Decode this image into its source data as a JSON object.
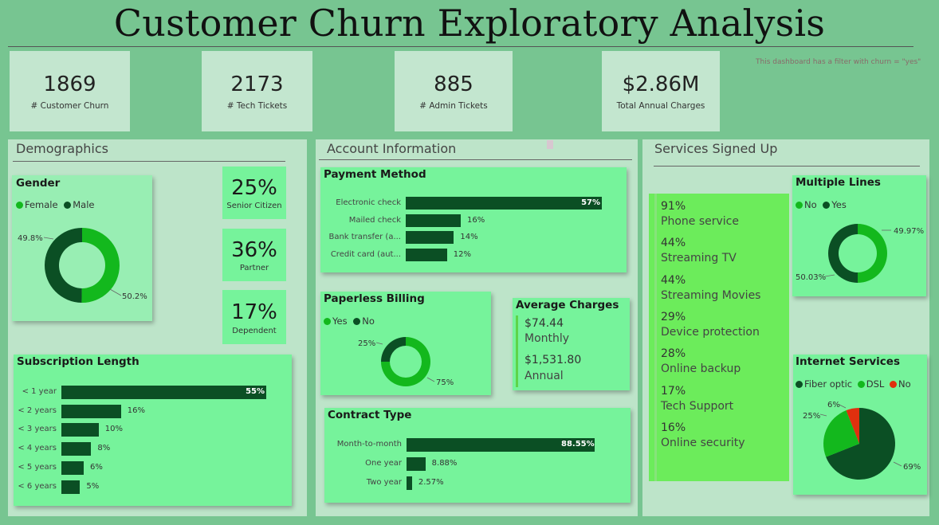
{
  "title": "Customer Churn Exploratory Analysis",
  "note": "This dashboard has a filter with churn = \"yes\"",
  "kpis": [
    {
      "value": "1869",
      "label": "# Customer Churn"
    },
    {
      "value": "2173",
      "label": "# Tech Tickets"
    },
    {
      "value": "885",
      "label": "# Admin Tickets"
    },
    {
      "value": "$2.86M",
      "label": "Total Annual Charges"
    }
  ],
  "demographics": {
    "title": "Demographics",
    "gender": {
      "title": "Gender",
      "legend": [
        "Female",
        "Male"
      ],
      "colors": {
        "female": "#13b81d",
        "male": "#0b4f24"
      },
      "female_pct": 50.2,
      "male_pct": 49.8,
      "female_label": "50.2%",
      "male_label": "49.8%"
    },
    "stats": [
      {
        "value": "25%",
        "label": "Senior Citizen"
      },
      {
        "value": "36%",
        "label": "Partner"
      },
      {
        "value": "17%",
        "label": "Dependent"
      }
    ],
    "subscription": {
      "title": "Subscription Length",
      "rows": [
        {
          "label": "< 1 year",
          "value": 55,
          "text": "55%"
        },
        {
          "label": "< 2 years",
          "value": 16,
          "text": "16%"
        },
        {
          "label": "< 3 years",
          "value": 10,
          "text": "10%"
        },
        {
          "label": "< 4 years",
          "value": 8,
          "text": "8%"
        },
        {
          "label": "< 5 years",
          "value": 6,
          "text": "6%"
        },
        {
          "label": "< 6 years",
          "value": 5,
          "text": "5%"
        }
      ]
    }
  },
  "account": {
    "title": "Account Information",
    "payment": {
      "title": "Payment Method",
      "rows": [
        {
          "label": "Electronic check",
          "value": 57,
          "text": "57%"
        },
        {
          "label": "Mailed check",
          "value": 16,
          "text": "16%"
        },
        {
          "label": "Bank transfer (a...",
          "value": 14,
          "text": "14%"
        },
        {
          "label": "Credit card (aut...",
          "value": 12,
          "text": "12%"
        }
      ]
    },
    "paperless": {
      "title": "Paperless Billing",
      "legend": [
        "Yes",
        "No"
      ],
      "yes_pct": 75,
      "no_pct": 25,
      "yes_label": "75%",
      "no_label": "25%"
    },
    "avg_charges": {
      "title": "Average Charges",
      "monthly_value": "$74.44",
      "monthly_label": "Monthly",
      "annual_value": "$1,531.80",
      "annual_label": "Annual"
    },
    "contract": {
      "title": "Contract Type",
      "rows": [
        {
          "label": "Month-to-month",
          "value": 88.55,
          "text": "88.55%"
        },
        {
          "label": "One year",
          "value": 8.88,
          "text": "8.88%"
        },
        {
          "label": "Two year",
          "value": 2.57,
          "text": "2.57%"
        }
      ]
    }
  },
  "services": {
    "title": "Services Signed Up",
    "items": [
      {
        "pct": "91%",
        "name": "Phone service"
      },
      {
        "pct": "44%",
        "name": "Streaming TV"
      },
      {
        "pct": "44%",
        "name": "Streaming Movies"
      },
      {
        "pct": "29%",
        "name": "Device protection"
      },
      {
        "pct": "28%",
        "name": "Online backup"
      },
      {
        "pct": "17%",
        "name": "Tech Support"
      },
      {
        "pct": "16%",
        "name": "Online security"
      }
    ],
    "multiple_lines": {
      "title": "Multiple Lines",
      "legend": [
        "No",
        "Yes"
      ],
      "no_pct": 49.97,
      "yes_pct": 50.03,
      "no_label": "49.97%",
      "yes_label": "50.03%"
    },
    "internet": {
      "title": "Internet Services",
      "legend": [
        "Fiber optic",
        "DSL",
        "No"
      ],
      "colors": {
        "fiber": "#0b4f24",
        "dsl": "#13b81d",
        "no": "#e0300e"
      },
      "fiber_pct": 69,
      "dsl_pct": 25,
      "no_pct": 6,
      "fiber_label": "69%",
      "dsl_label": "25%",
      "no_label": "6%"
    }
  }
}
